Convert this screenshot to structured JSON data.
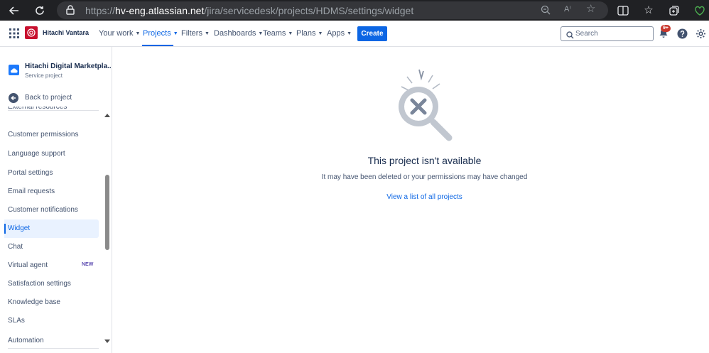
{
  "browser": {
    "url_scheme": "https://",
    "url_host": "hv-eng.atlassian.net",
    "url_path": "/jira/servicedesk/projects/HDMS/settings/widget"
  },
  "topnav": {
    "brand_name": "Hitachi Vantara",
    "items": [
      {
        "label": "Your work"
      },
      {
        "label": "Projects"
      },
      {
        "label": "Filters"
      },
      {
        "label": "Dashboards"
      },
      {
        "label": "Teams"
      },
      {
        "label": "Plans"
      },
      {
        "label": "Apps"
      }
    ],
    "active_item": "Projects",
    "create_label": "Create",
    "search_placeholder": "Search",
    "notification_count": "9+"
  },
  "sidebar": {
    "project_name": "Hitachi Digital Marketpla...",
    "project_type": "Service project",
    "back_label": "Back to project",
    "clipped_item": "External resources",
    "items": [
      {
        "label": "Customer permissions"
      },
      {
        "label": "Language support"
      },
      {
        "label": "Portal settings"
      },
      {
        "label": "Email requests"
      },
      {
        "label": "Customer notifications"
      },
      {
        "label": "Widget"
      },
      {
        "label": "Chat"
      },
      {
        "label": "Virtual agent",
        "lozenge": "NEW"
      },
      {
        "label": "Satisfaction settings"
      },
      {
        "label": "Knowledge base"
      },
      {
        "label": "SLAs"
      },
      {
        "label": "Automation"
      }
    ],
    "selected_item": "Widget"
  },
  "main": {
    "title": "This project isn't available",
    "description": "It may have been deleted or your permissions may have changed",
    "link_label": "View a list of all projects"
  },
  "colors": {
    "accent": "#0c66e4",
    "brand": "#c8102e",
    "badge": "#c9372c",
    "selected_bg": "#e9f2ff"
  }
}
